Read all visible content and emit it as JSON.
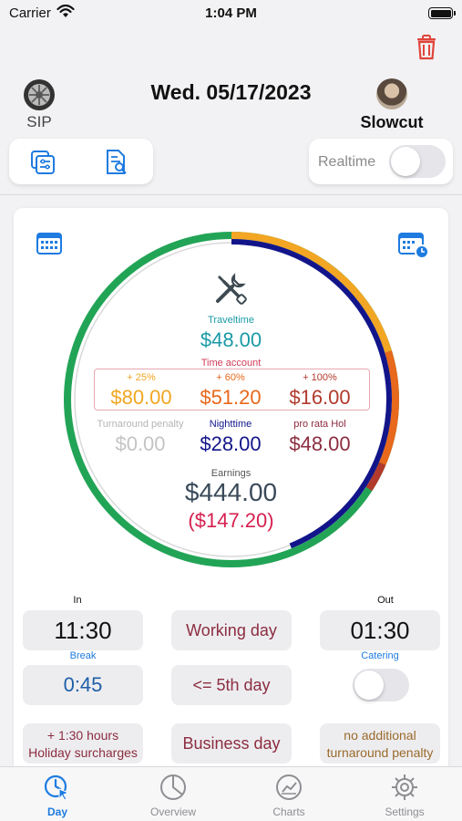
{
  "status_bar": {
    "carrier": "Carrier",
    "time": "1:04 PM"
  },
  "header": {
    "title": "Wed. 05/17/2023",
    "vehicle_label": "SIP",
    "profile_name": "Slowcut"
  },
  "realtime": {
    "label": "Realtime",
    "enabled": false
  },
  "summary": {
    "traveltime_label": "Traveltime",
    "traveltime_value": "$48.00",
    "time_account_label": "Time account",
    "surcharge_25_label": "+ 25%",
    "surcharge_25_value": "$80.00",
    "surcharge_60_label": "+ 60%",
    "surcharge_60_value": "$51.20",
    "surcharge_100_label": "+ 100%",
    "surcharge_100_value": "$16.00",
    "turnaround_label": "Turnaround penalty",
    "turnaround_value": "$0.00",
    "nighttime_label": "Nighttime",
    "nighttime_value": "$28.00",
    "prorata_label": "pro rata Hol",
    "prorata_value": "$48.00",
    "earnings_label": "Earnings",
    "earnings_value": "$444.00",
    "deduction_value": "($147.20)"
  },
  "shift": {
    "in_label": "In",
    "in_time": "11:30",
    "out_label": "Out",
    "out_time": "01:30",
    "break_label": "Break",
    "break_value": "0:45",
    "catering_label": "Catering",
    "catering_enabled": false,
    "day_type": "Working day",
    "day_count": "<= 5th day",
    "holiday_line1": "+ 1:30 hours",
    "holiday_line2": "Holiday surcharges",
    "business_day": "Business day",
    "turnaround_line1": "no additional",
    "turnaround_line2": "turnaround penalty"
  },
  "tabs": [
    {
      "label": "Day",
      "icon": "clock-icon",
      "active": true
    },
    {
      "label": "Overview",
      "icon": "pie-chart-icon",
      "active": false
    },
    {
      "label": "Charts",
      "icon": "line-chart-icon",
      "active": false
    },
    {
      "label": "Settings",
      "icon": "gear-icon",
      "active": false
    }
  ],
  "colors": {
    "accent": "#1e7be0",
    "green": "#22a456",
    "navy": "#12158a",
    "amber": "#f2a623",
    "orange": "#e8681c",
    "maroon": "#8c2d3f",
    "teal": "#1a9aa6",
    "trash": "#e0443a"
  }
}
